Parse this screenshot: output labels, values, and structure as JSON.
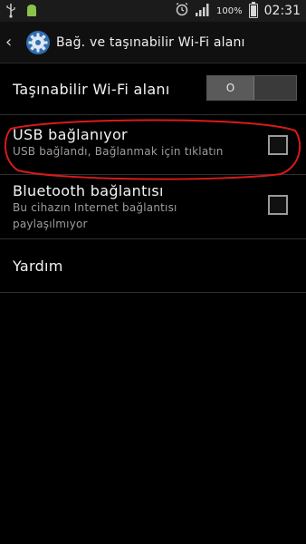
{
  "status_bar": {
    "battery_percent": "100%",
    "time": "02:31",
    "icons": [
      "usb-icon",
      "android-icon",
      "alarm-icon",
      "signal-icon",
      "battery-icon"
    ]
  },
  "header": {
    "title": "Bağ. ve taşınabilir Wi-Fi alanı"
  },
  "settings": {
    "hotspot": {
      "label": "Taşınabilir Wi-Fi alanı",
      "toggle_state_text": "O"
    },
    "usb": {
      "label": "USB bağlanıyor",
      "sub": "USB bağlandı, Bağlanmak için tıklatın",
      "checked": false
    },
    "bluetooth": {
      "label": "Bluetooth bağlantısı",
      "sub_line1": "Bu cihazın Internet bağlantısı",
      "sub_line2": "paylaşılmıyor",
      "checked": false
    },
    "help": {
      "label": "Yardım"
    }
  },
  "colors": {
    "background": "#000000",
    "annotation_red": "#d81a1a",
    "accent_blue": "#3b8fd6"
  }
}
